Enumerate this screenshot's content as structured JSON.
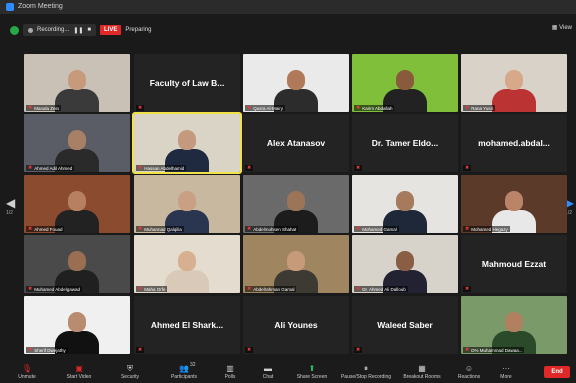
{
  "window": {
    "title": "Zoom Meeting"
  },
  "status": {
    "recording": "Recording...",
    "live": "LIVE",
    "preparing": "Preparing",
    "view": "View"
  },
  "pager": {
    "left": "1/2",
    "right": "1/2"
  },
  "participants": [
    {
      "name": "Manala Zein",
      "kind": "video",
      "bg": "#c9c0b6",
      "skin": "#c79a7c",
      "body": "#3a3a3a"
    },
    {
      "name": "Faculty of Law B...",
      "kind": "name"
    },
    {
      "name": "Qusra Al-Mairy",
      "kind": "video",
      "bg": "#eaeaea",
      "skin": "#b07a5a",
      "body": "#2c2c2c"
    },
    {
      "name": "Karim Abdallah",
      "kind": "video",
      "bg": "#7fbf3a",
      "skin": "#8a5a3c",
      "body": "#222"
    },
    {
      "name": "Rana Yusri",
      "kind": "video",
      "bg": "#d8d2c9",
      "skin": "#d8a88a",
      "body": "#b33"
    },
    {
      "name": "Ahmed Adil Ahmed",
      "kind": "video",
      "bg": "#5a5d66",
      "skin": "#a88066",
      "body": "#2a2a2a"
    },
    {
      "name": "Hassan Abdelhamid",
      "kind": "video",
      "bg": "#d9d4c6",
      "skin": "#c49a7e",
      "body": "#1f2a40"
    },
    {
      "name": "Alex Atanasov",
      "kind": "name"
    },
    {
      "name": "Dr. Tamer Eldo...",
      "kind": "name"
    },
    {
      "name": "mohamed.abdal...",
      "kind": "name"
    },
    {
      "name": "Ahmed Fouad",
      "kind": "video",
      "bg": "#8a4b2f",
      "skin": "#b78060",
      "body": "#222"
    },
    {
      "name": "Muhannad Qalqilia",
      "kind": "video",
      "bg": "#c8b8a0",
      "skin": "#c9a083",
      "body": "#2a3550"
    },
    {
      "name": "Abdelmohsen Shahat",
      "kind": "video",
      "bg": "#6a6a6a",
      "skin": "#9c7458",
      "body": "#1c1c1c"
    },
    {
      "name": "Mohamed Gamal",
      "kind": "video",
      "bg": "#e6e4e0",
      "skin": "#a57a5d",
      "body": "#1e2838"
    },
    {
      "name": "Mohamed Hegazy",
      "kind": "video",
      "bg": "#5c3a2a",
      "skin": "#b98467",
      "body": "#e8e8e8"
    },
    {
      "name": "Muhamed Abdelgawad",
      "kind": "video",
      "bg": "#4a4a4a",
      "skin": "#9a6e52",
      "body": "#202020"
    },
    {
      "name": "Maha Orfe",
      "kind": "video",
      "bg": "#e4dccf",
      "skin": "#d6b090",
      "body": "#d9c9b8"
    },
    {
      "name": "Abdelrahman Gamal",
      "kind": "video",
      "bg": "#a08660",
      "skin": "#c79a7a",
      "body": "#3d3a33"
    },
    {
      "name": "Dr. Ahmed Ali Dalloub",
      "kind": "video",
      "bg": "#d7d3cb",
      "skin": "#8a5e44",
      "body": "#223"
    },
    {
      "name": "Mahmoud Ezzat",
      "kind": "name"
    },
    {
      "name": "Sherif Dwejathy",
      "kind": "video",
      "bg": "#f0f0f0",
      "skin": "#b98b70",
      "body": "#111"
    },
    {
      "name": "Ahmed El Shark...",
      "kind": "name"
    },
    {
      "name": "Ali Younes",
      "kind": "name"
    },
    {
      "name": "Waleed Saber",
      "kind": "name"
    },
    {
      "name": "D% Muhammad Dawaa...",
      "kind": "video",
      "bg": "#7a9a6a",
      "skin": "#b08060",
      "body": "#2a4a2a"
    }
  ],
  "toolbar": [
    {
      "label": "Unmute",
      "icon": "mic-muted-icon",
      "glyph": "🎙",
      "red": true
    },
    {
      "label": "Start Video",
      "icon": "video-off-icon",
      "glyph": "▣",
      "red": true
    },
    {
      "label": "Security",
      "icon": "shield-icon",
      "glyph": "⛨"
    },
    {
      "label": "Participants",
      "icon": "participants-icon",
      "glyph": "👥",
      "badge": "32"
    },
    {
      "label": "Polls",
      "icon": "polls-icon",
      "glyph": "▥"
    },
    {
      "label": "Chat",
      "icon": "chat-icon",
      "glyph": "▬"
    },
    {
      "label": "Share Screen",
      "icon": "share-screen-icon",
      "glyph": "⬆",
      "green": true
    },
    {
      "label": "Pause/Stop Recording",
      "icon": "pause-recording-icon",
      "glyph": "⏸"
    },
    {
      "label": "Breakout Rooms",
      "icon": "breakout-rooms-icon",
      "glyph": "▦"
    },
    {
      "label": "Reactions",
      "icon": "reactions-icon",
      "glyph": "☺"
    },
    {
      "label": "More",
      "icon": "more-icon",
      "glyph": "···"
    }
  ],
  "end_label": "End"
}
